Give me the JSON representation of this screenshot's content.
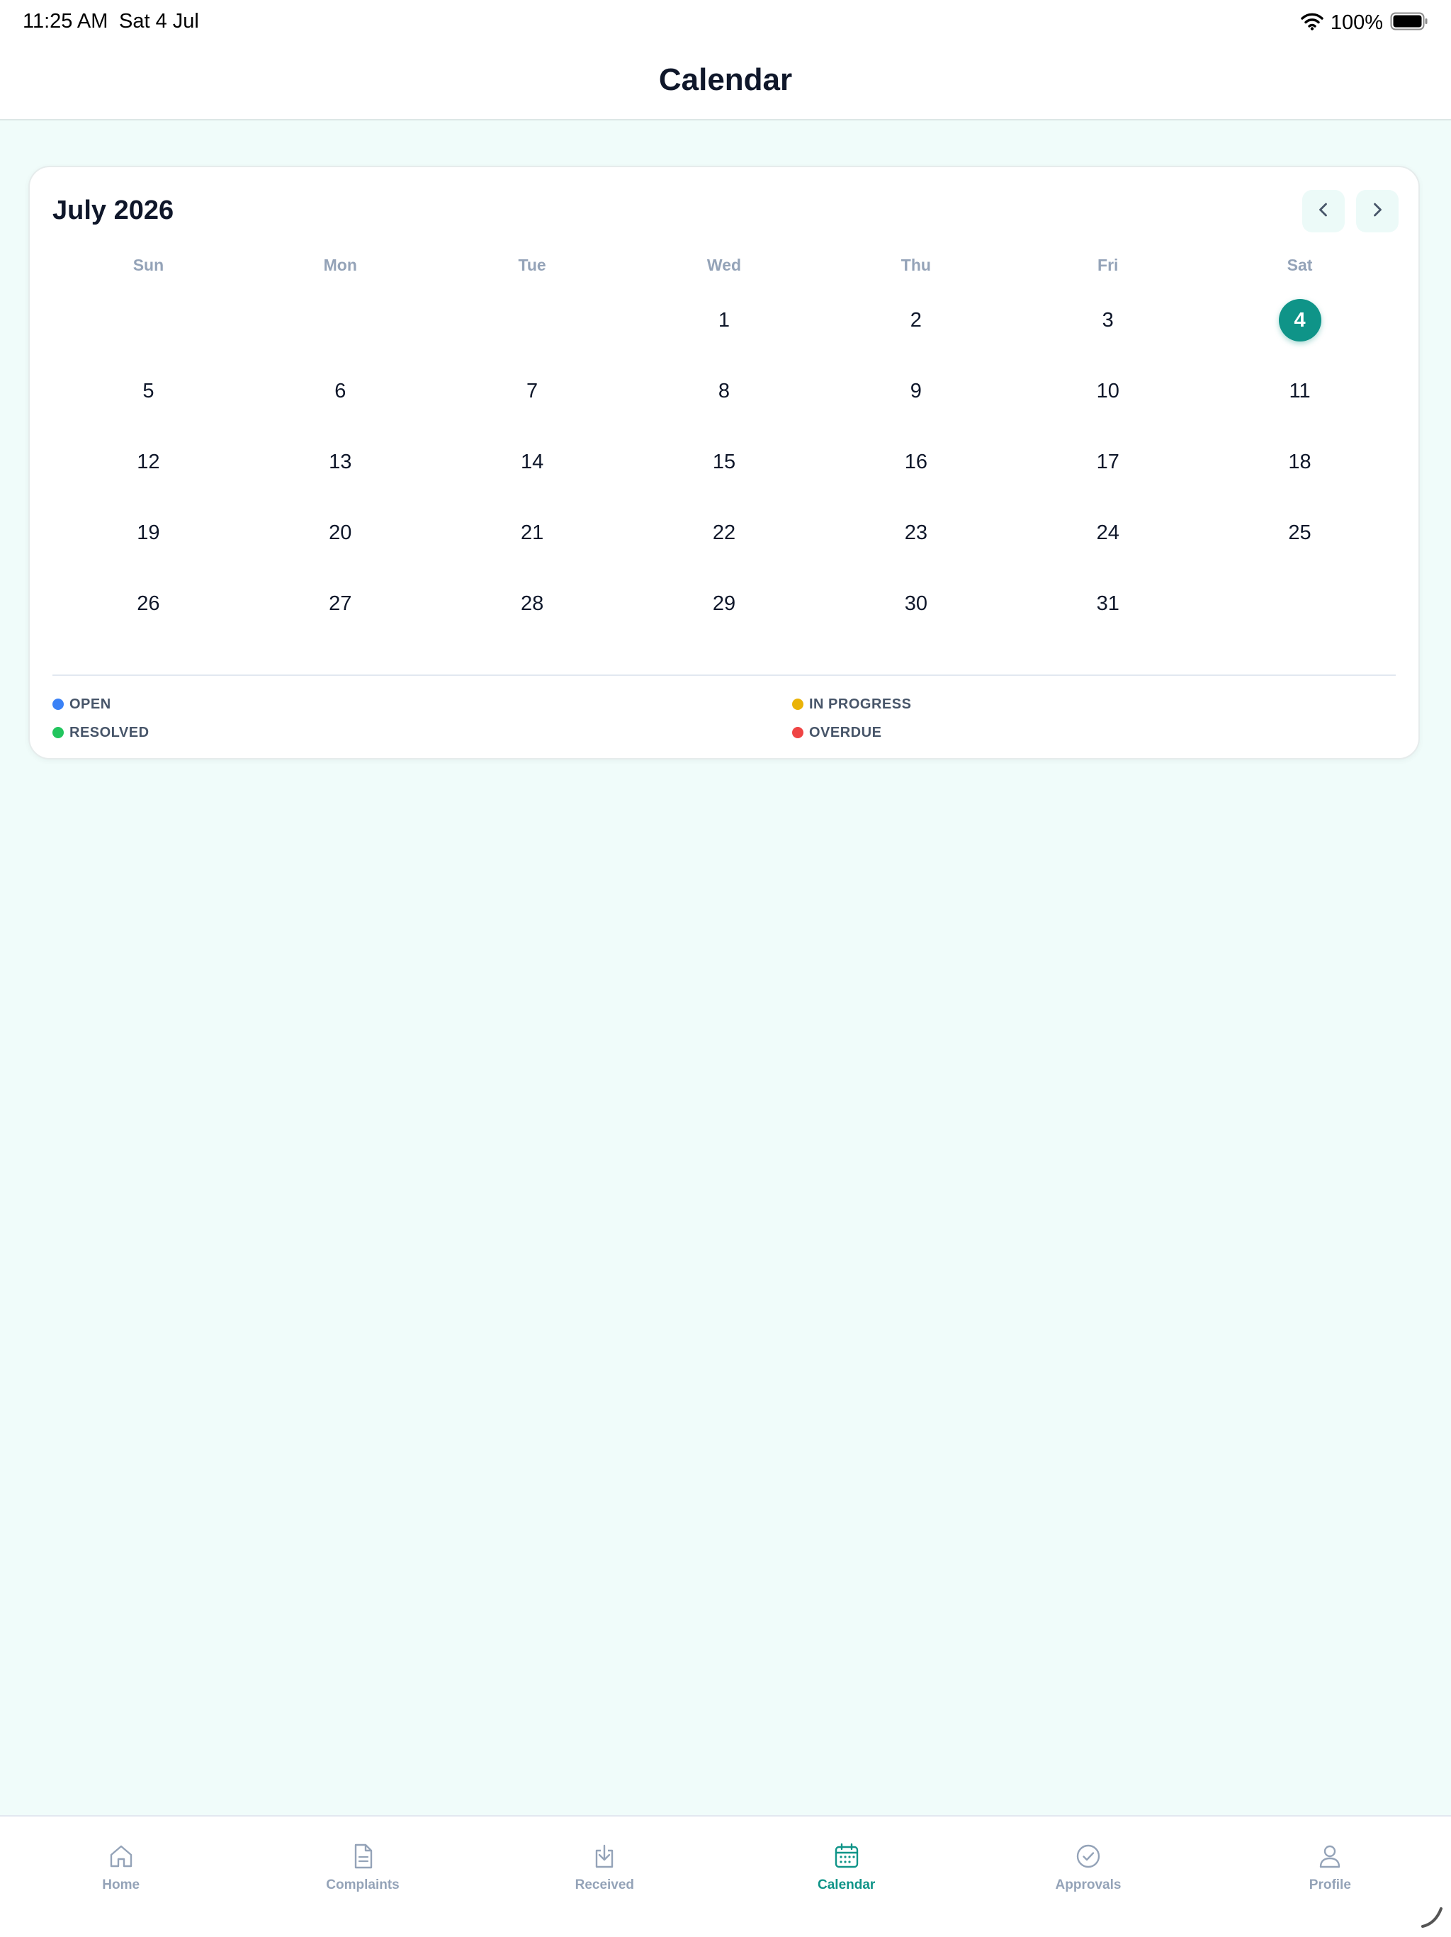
{
  "status_bar": {
    "time": "11:25 AM",
    "date": "Sat 4 Jul",
    "battery": "100%",
    "icons": [
      "wifi-icon",
      "battery-icon"
    ]
  },
  "header": {
    "title": "Calendar"
  },
  "calendar": {
    "month_label": "July 2026",
    "prev_icon": "chevron-left-icon",
    "next_icon": "chevron-right-icon",
    "weekdays": [
      "Sun",
      "Mon",
      "Tue",
      "Wed",
      "Thu",
      "Fri",
      "Sat"
    ],
    "days": [
      "",
      "",
      "",
      "1",
      "2",
      "3",
      "4",
      "5",
      "6",
      "7",
      "8",
      "9",
      "10",
      "11",
      "12",
      "13",
      "14",
      "15",
      "16",
      "17",
      "18",
      "19",
      "20",
      "21",
      "22",
      "23",
      "24",
      "25",
      "26",
      "27",
      "28",
      "29",
      "30",
      "31",
      ""
    ],
    "selected_day": "4",
    "accent_color": "#0f9488"
  },
  "legend": [
    {
      "label": "OPEN",
      "color": "#3b82f6"
    },
    {
      "label": "IN PROGRESS",
      "color": "#eab308"
    },
    {
      "label": "RESOLVED",
      "color": "#22c55e"
    },
    {
      "label": "OVERDUE",
      "color": "#ef4444"
    }
  ],
  "tabs": [
    {
      "key": "home",
      "label": "Home",
      "icon": "home-icon",
      "active": false
    },
    {
      "key": "complaints",
      "label": "Complaints",
      "icon": "document-icon",
      "active": false
    },
    {
      "key": "received",
      "label": "Received",
      "icon": "inbox-download-icon",
      "active": false
    },
    {
      "key": "calendar",
      "label": "Calendar",
      "icon": "calendar-icon",
      "active": true
    },
    {
      "key": "approvals",
      "label": "Approvals",
      "icon": "check-circle-icon",
      "active": false
    },
    {
      "key": "profile",
      "label": "Profile",
      "icon": "user-icon",
      "active": false
    }
  ],
  "colors": {
    "background": "#f0fcfa",
    "inactive_tab": "#94a3b8",
    "active_tab": "#0f9488"
  }
}
